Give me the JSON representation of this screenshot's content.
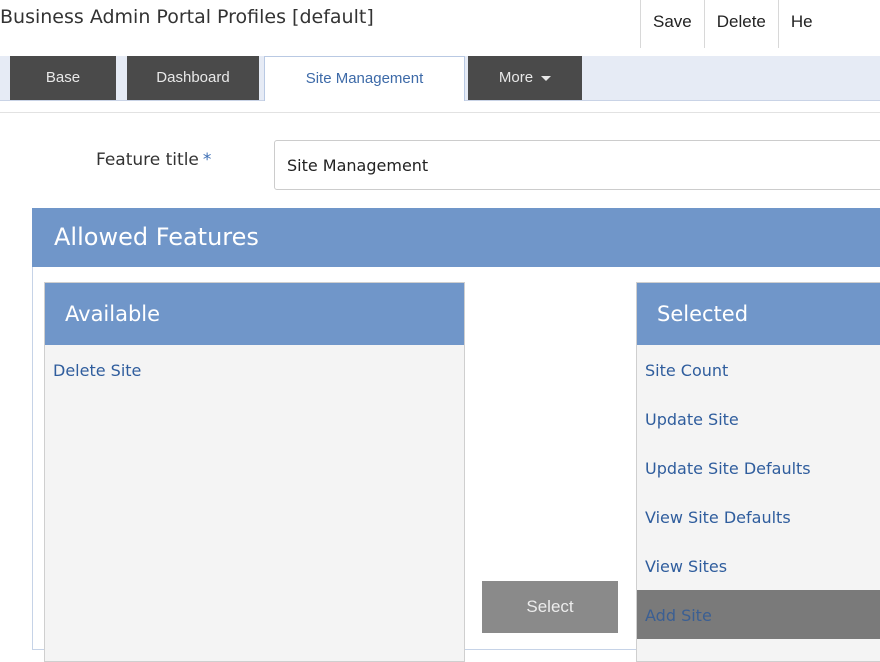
{
  "header": {
    "title": "Business Admin Portal Profiles [default]",
    "actions": [
      "Save",
      "Delete",
      "He"
    ]
  },
  "tabs": {
    "base": "Base",
    "dashboard": "Dashboard",
    "site_management": "Site Management",
    "more": "More",
    "active": "Site Management"
  },
  "form": {
    "feature_title_label": "Feature title",
    "required_marker": "*",
    "feature_title_value": "Site Management"
  },
  "allowed_features": {
    "title": "Allowed Features",
    "available": {
      "title": "Available",
      "items": [
        "Delete Site"
      ]
    },
    "selected": {
      "title": "Selected",
      "items": [
        "Site Count",
        "Update Site",
        "Update Site Defaults",
        "View Site Defaults",
        "View Sites",
        "Add Site"
      ],
      "highlighted": "Add Site"
    },
    "select_button": "Select"
  },
  "colors": {
    "panel_header": "#7096c9",
    "link": "#2f5d9d",
    "tab_dark": "#4a4a4a"
  }
}
